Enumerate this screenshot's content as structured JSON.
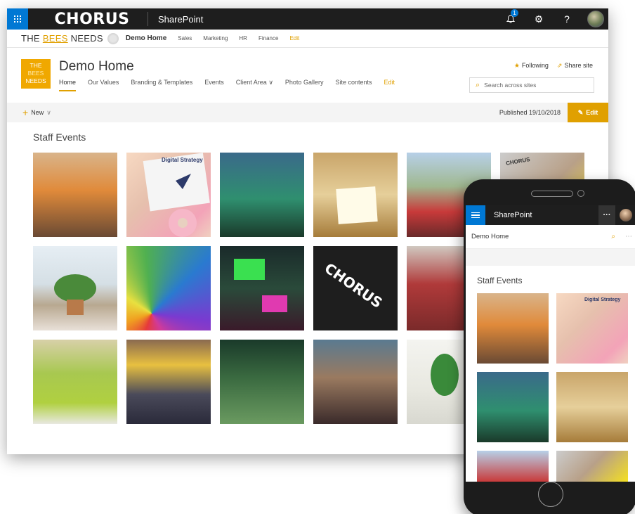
{
  "suitebar": {
    "brand": "CHORUS",
    "app_name": "SharePoint",
    "notification_count": "1",
    "settings_glyph": "⚙",
    "help_glyph": "?"
  },
  "hub": {
    "logo_prefix": "THE ",
    "logo_bees": "BEES",
    "logo_suffix": " NEEDS",
    "title": "Demo Home",
    "links": [
      "Sales",
      "Marketing",
      "HR",
      "Finance"
    ],
    "edit": "Edit"
  },
  "site": {
    "logo_lines": [
      "THE",
      "BEES",
      "NEEDS"
    ],
    "title": "Demo Home",
    "nav": {
      "home": "Home",
      "values": "Our Values",
      "branding": "Branding & Templates",
      "events": "Events",
      "client_area": "Client Area",
      "photo_gallery": "Photo Gallery",
      "site_contents": "Site contents",
      "edit": "Edit"
    },
    "following": "Following",
    "share": "Share site",
    "search_placeholder": "Search across sites"
  },
  "commandbar": {
    "new": "New",
    "published": "Published 19/10/2018",
    "edit": "Edit"
  },
  "gallery": {
    "title": "Staff Events",
    "tile_labels": [
      "Digital Strategy",
      "CHORUS"
    ]
  },
  "mobile": {
    "app_name": "SharePoint",
    "more": "···",
    "site_title": "Demo Home",
    "section_title": "Staff Events",
    "tile_labels": [
      "Digital Strategy"
    ]
  },
  "colors": {
    "accent": "#e0a000",
    "suitebar": "#1e1e1e",
    "waffle": "#0078d4"
  }
}
